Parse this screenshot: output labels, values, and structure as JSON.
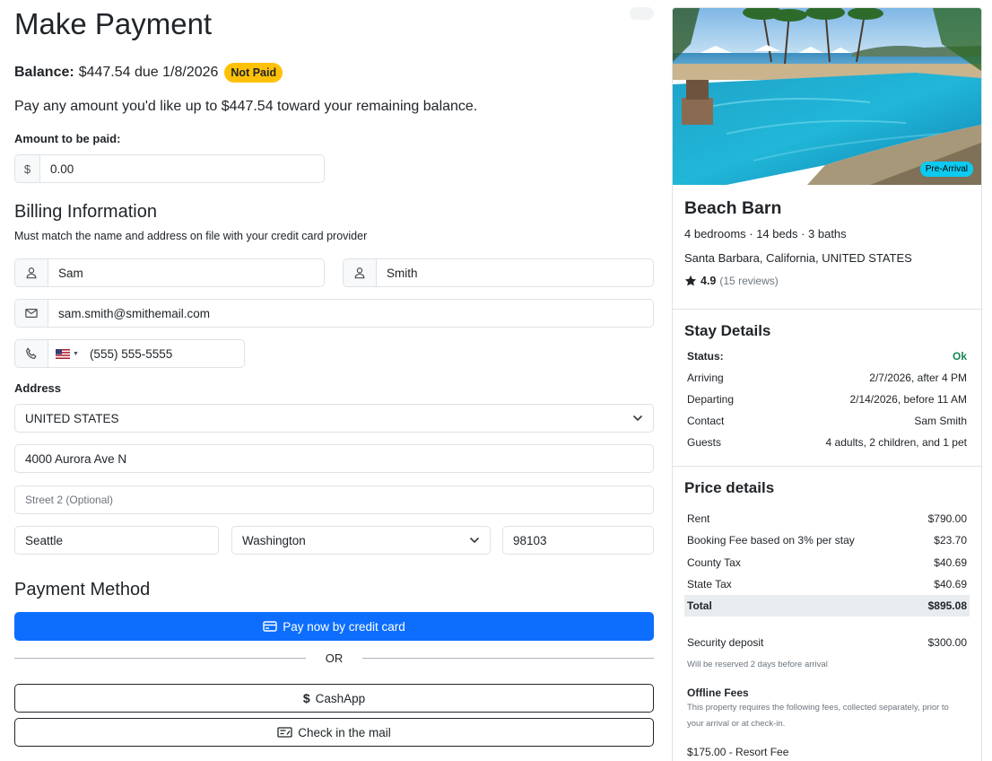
{
  "page": {
    "title": "Make Payment",
    "balance_label": "Balance:",
    "balance_text": "$447.54 due 1/8/2026",
    "status_badge": "Not Paid",
    "description": "Pay any amount you'd like up to $447.54 toward your remaining balance.",
    "amount_label": "Amount to be paid:",
    "currency_symbol": "$",
    "amount_value": "0.00"
  },
  "billing": {
    "title": "Billing Information",
    "subtitle": "Must match the name and address on file with your credit card provider",
    "first_name": "Sam",
    "last_name": "Smith",
    "email": "sam.smith@smithemail.com",
    "phone": "(555) 555-5555",
    "phone_country": "US"
  },
  "address": {
    "label": "Address",
    "country": "UNITED STATES",
    "street1": "4000 Aurora Ave N",
    "street2_placeholder": "Street 2 (Optional)",
    "city": "Seattle",
    "state": "Washington",
    "zip": "98103"
  },
  "payment": {
    "title": "Payment Method",
    "credit_card_button": "Pay now by credit card",
    "or_text": "OR",
    "cashapp_button": "CashApp",
    "check_button": "Check in the mail",
    "primary_color": "#0d6efd"
  },
  "property": {
    "badge": "Pre-Arrival",
    "name": "Beach Barn",
    "beds_line": "4 bedrooms · 14 beds · 3 baths",
    "location": "Santa Barbara, California, UNITED STATES",
    "rating": "4.9",
    "reviews": "(15 reviews)"
  },
  "stay": {
    "title": "Stay Details",
    "status_label": "Status:",
    "status_value": "Ok",
    "rows": [
      {
        "label": "Arriving",
        "value": "2/7/2026, after 4 PM"
      },
      {
        "label": "Departing",
        "value": "2/14/2026, before 11 AM"
      },
      {
        "label": "Contact",
        "value": "Sam Smith"
      },
      {
        "label": "Guests",
        "value": "4 adults, 2 children, and 1 pet"
      }
    ]
  },
  "price": {
    "title": "Price details",
    "rows": [
      {
        "label": "Rent",
        "value": "$790.00"
      },
      {
        "label": "Booking Fee based on 3% per stay",
        "value": "$23.70"
      },
      {
        "label": "County Tax",
        "value": "$40.69"
      },
      {
        "label": "State Tax",
        "value": "$40.69"
      }
    ],
    "total_label": "Total",
    "total_value": "$895.08",
    "deposit_label": "Security deposit",
    "deposit_value": "$300.00",
    "deposit_note": "Will be reserved 2 days before arrival",
    "offline_title": "Offline Fees",
    "offline_note": "This property requires the following fees, collected separately, prior to your arrival or at check-in.",
    "resort_fee": "$175.00 - Resort Fee"
  }
}
